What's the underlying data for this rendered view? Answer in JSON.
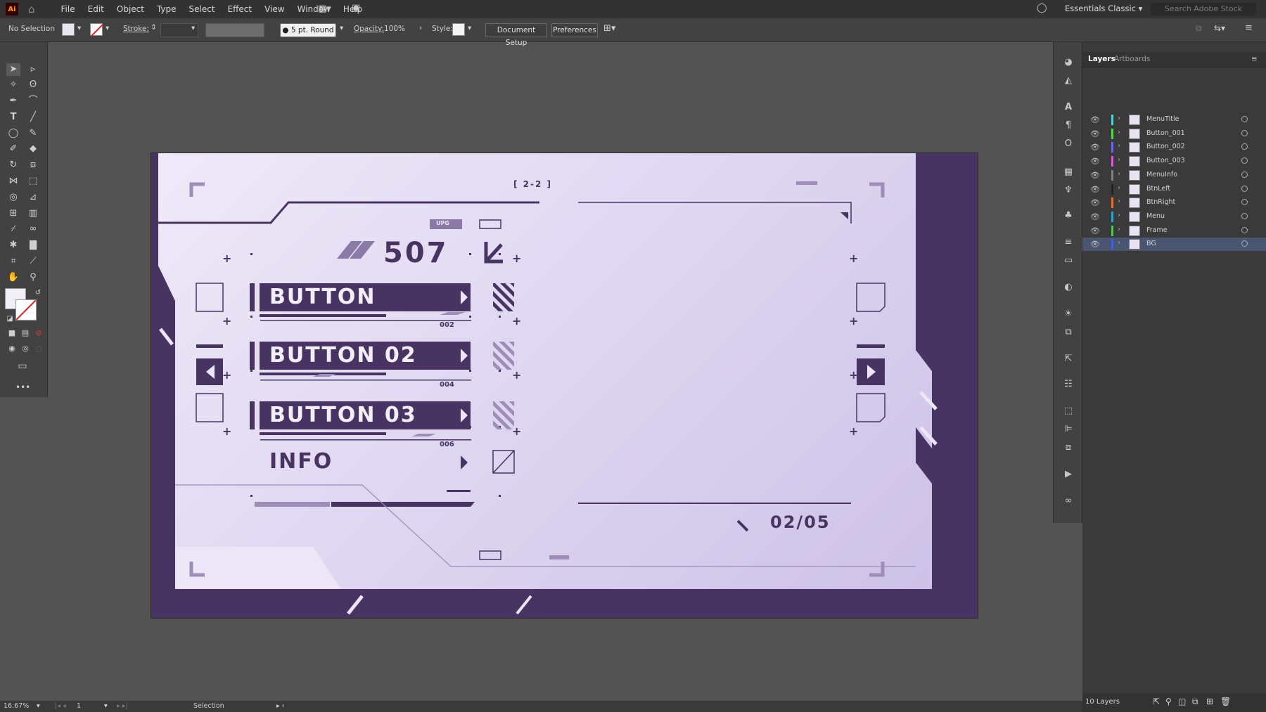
{
  "app": {
    "menus": [
      "File",
      "Edit",
      "Object",
      "Type",
      "Select",
      "Effect",
      "View",
      "Window",
      "Help"
    ],
    "workspace": "Essentials Classic",
    "search_placeholder": "Search Adobe Stock"
  },
  "control_bar": {
    "selection": "No Selection",
    "stroke_label": "Stroke:",
    "brush": "5 pt. Round",
    "opacity_label": "Opacity:",
    "opacity_value": "100%",
    "style_label": "Style:",
    "document_setup": "Document Setup",
    "preferences": "Preferences"
  },
  "layers_panel": {
    "tabs": [
      "Layers",
      "Artboards"
    ],
    "layers": [
      {
        "name": "MenuTitle",
        "color": "#4fd0d8"
      },
      {
        "name": "Button_001",
        "color": "#4fd84f"
      },
      {
        "name": "Button_002",
        "color": "#6a6af0"
      },
      {
        "name": "Button_003",
        "color": "#d85ad8"
      },
      {
        "name": "MenuInfo",
        "color": "#808080"
      },
      {
        "name": "BtnLeft",
        "color": "#222222"
      },
      {
        "name": "BtnRight",
        "color": "#e07030"
      },
      {
        "name": "Menu",
        "color": "#30a0d0"
      },
      {
        "name": "Frame",
        "color": "#50c850"
      },
      {
        "name": "BG",
        "color": "#4060e0"
      }
    ],
    "footer_count": "10 Layers"
  },
  "status_bar": {
    "zoom": "16.67%",
    "artboard_number": "1",
    "tool": "Selection"
  },
  "artwork": {
    "page_tag": "[ 2-2 ]",
    "tag_small": "UPG",
    "title_number": "507",
    "buttons": [
      {
        "label": "BUTTON",
        "code": "002"
      },
      {
        "label": "BUTTON 02",
        "code": "004"
      },
      {
        "label": "BUTTON 03",
        "code": "006"
      }
    ],
    "info_label": "INFO",
    "page_counter": "02/05",
    "colors": {
      "dark": "#473463",
      "light": "#ece6f7",
      "mid": "#9d8db8"
    }
  }
}
